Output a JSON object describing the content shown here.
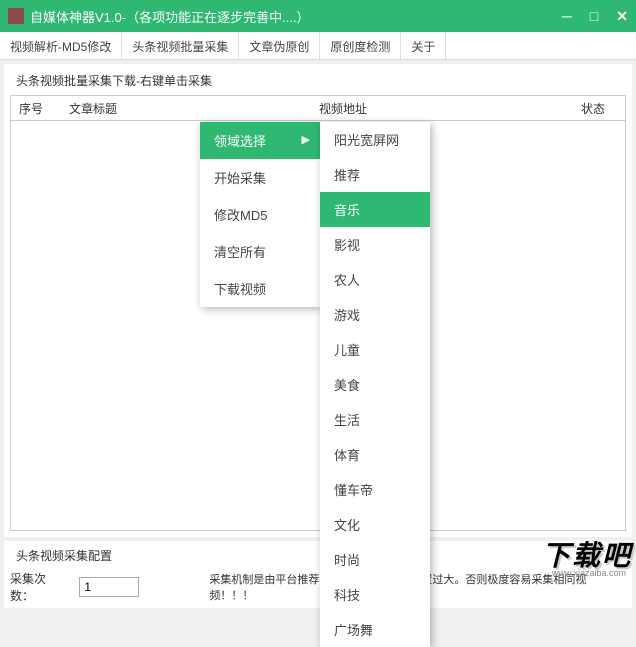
{
  "titlebar": {
    "title": "自媒体神器V1.0-（各项功能正在逐步完善中....）"
  },
  "tabs": [
    "视频解析-MD5修改",
    "头条视频批量采集",
    "文章伪原创",
    "原创度检测",
    "关于"
  ],
  "group1_label": "头条视频批量采集下载-右键单击采集",
  "table_headers": {
    "seq": "序号",
    "title": "文章标题",
    "url": "视频地址",
    "status": "状态"
  },
  "context_menu": {
    "items": [
      {
        "label": "领域选择",
        "has_sub": true,
        "active": true
      },
      {
        "label": "开始采集"
      },
      {
        "label": "修改MD5"
      },
      {
        "label": "清空所有"
      },
      {
        "label": "下载视频"
      }
    ]
  },
  "submenu": {
    "items": [
      "阳光宽屏网",
      "推荐",
      "音乐",
      "影视",
      "农人",
      "游戏",
      "儿童",
      "美食",
      "生活",
      "体育",
      "懂车帝",
      "文化",
      "时尚",
      "科技",
      "广场舞"
    ],
    "active_index": 2
  },
  "bottom": {
    "group_label": "头条视频采集配置",
    "count_label": "采集次数：",
    "count_value": "1",
    "notice": "采集机制是由平台推荐采集  采集次数请勿设置过大。否则极度容易采集相同视频！！！"
  },
  "watermark": {
    "text": "下载吧",
    "url": "www.xiazaiba.com"
  }
}
